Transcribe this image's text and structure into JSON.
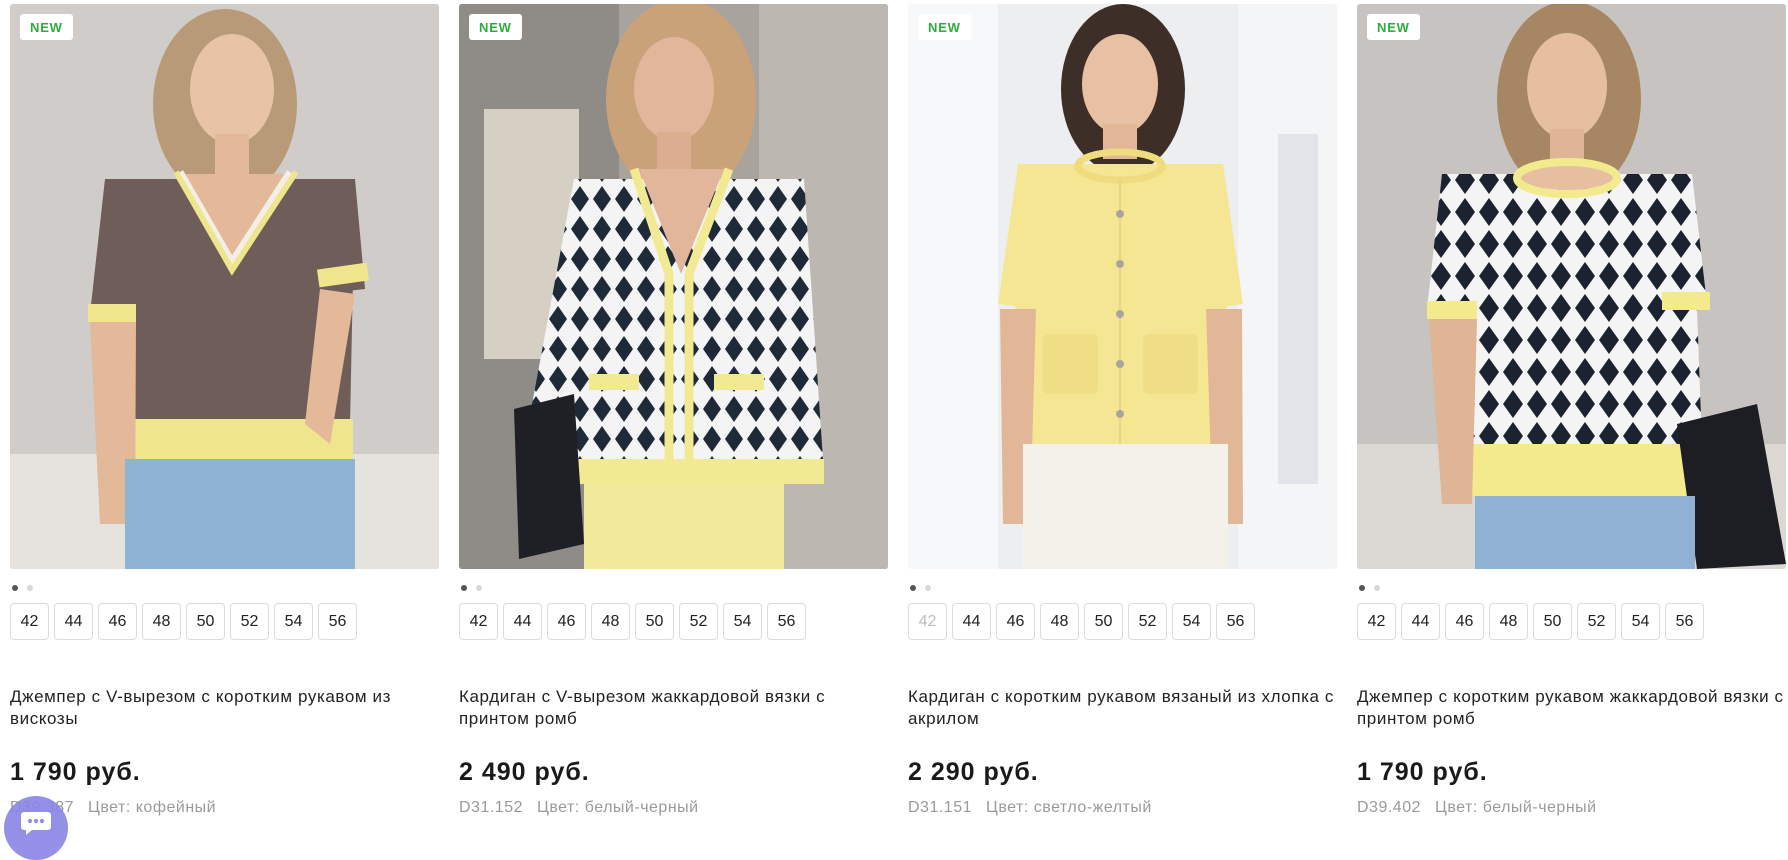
{
  "products": [
    {
      "badge": "NEW",
      "title": "Джемпер с V-вырезом с коротким рукавом из вискозы",
      "price": "1 790 руб.",
      "sku": "D39.387",
      "color_label": "Цвет: кофейный",
      "photo_icon": "product-photo-brown-vneck-jumper",
      "sizes": [
        "42",
        "44",
        "46",
        "48",
        "50",
        "52",
        "54",
        "56"
      ],
      "disabled_sizes": []
    },
    {
      "badge": "NEW",
      "title": "Кардиган с V-вырезом жаккардовой вязки с принтом ромб",
      "price": "2 490 руб.",
      "sku": "D31.152",
      "color_label": "Цвет: белый-черный",
      "photo_icon": "product-photo-diamond-cardigan",
      "sizes": [
        "42",
        "44",
        "46",
        "48",
        "50",
        "52",
        "54",
        "56"
      ],
      "disabled_sizes": []
    },
    {
      "badge": "NEW",
      "title": "Кардиган с коротким рукавом вязаный из хлопка с акрилом",
      "price": "2 290 руб.",
      "sku": "D31.151",
      "color_label": "Цвет: светло-желтый",
      "photo_icon": "product-photo-yellow-cardigan",
      "sizes": [
        "42",
        "44",
        "46",
        "48",
        "50",
        "52",
        "54",
        "56"
      ],
      "disabled_sizes": [
        "42"
      ]
    },
    {
      "badge": "NEW",
      "title": "Джемпер с коротким рукавом жаккардовой вязки с принтом ромб",
      "price": "1 790 руб.",
      "sku": "D39.402",
      "color_label": "Цвет: белый-черный",
      "photo_icon": "product-photo-diamond-jumper",
      "sizes": [
        "42",
        "44",
        "46",
        "48",
        "50",
        "52",
        "54",
        "56"
      ],
      "disabled_sizes": []
    }
  ],
  "carousel": {
    "dot_count": 2,
    "active_dot": 0
  },
  "chat_widget": {
    "icon": "chat-bubble-icon",
    "color": "#8b86e6"
  },
  "colors": {
    "badge_green": "#2fab3e",
    "text_primary": "#222222",
    "text_muted": "#9a9a9a",
    "size_border": "#dcdcdc"
  }
}
